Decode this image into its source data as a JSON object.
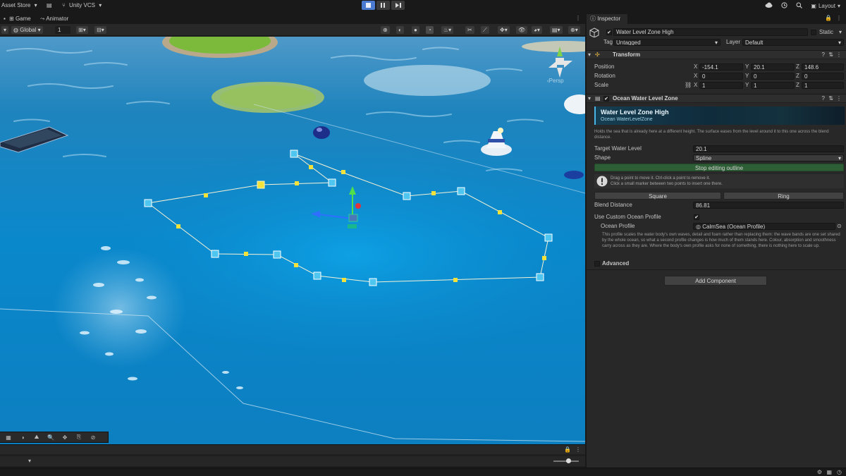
{
  "topbar": {
    "asset_store": "Asset Store",
    "vcs": "Unity VCS",
    "layout": "Layout"
  },
  "scene": {
    "tabs": [
      {
        "label": "Game"
      },
      {
        "label": "Animator"
      }
    ],
    "toolbar": {
      "pivot_space": "Global",
      "grid_value": "1"
    },
    "persp_label": "‹Persp"
  },
  "inspector": {
    "tab_label": "Inspector",
    "object": {
      "name": "Water Level Zone High",
      "static_label": "Static",
      "tag_label": "Tag",
      "tag_value": "Untagged",
      "layer_label": "Layer",
      "layer_value": "Default"
    },
    "transform": {
      "title": "Transform",
      "position_label": "Position",
      "rotation_label": "Rotation",
      "scale_label": "Scale",
      "x": "X",
      "y": "Y",
      "z": "Z",
      "position": [
        "-154.1",
        "20.1",
        "148.6"
      ],
      "rotation": [
        "0",
        "0",
        "0"
      ],
      "scale": [
        "1",
        "1",
        "1"
      ]
    },
    "zone": {
      "title": "Ocean Water Level Zone",
      "banner_title": "Water Level Zone High",
      "banner_subtitle": "Ocean WaterLevelZone",
      "description": "Holds the sea that is already here at a different height. The surface eases from the level around it to this one across the blend distance.",
      "target_label": "Target Water Level",
      "target_value": "20.1",
      "shape_label": "Shape",
      "shape_value": "Spline",
      "stop_editing": "Stop editing outline",
      "help_line1": "Drag a point to move it. Ctrl-click a point to remove it.",
      "help_line2": "Click a small marker between two points to insert one there.",
      "square_label": "Square",
      "ring_label": "Ring",
      "blend_label": "Blend Distance",
      "blend_value": "86.81",
      "custom_profile_label": "Use Custom Ocean Profile",
      "custom_profile_check": "✔",
      "profile_label": "Ocean Profile",
      "profile_value": "CalmSea (Ocean Profile)",
      "profile_desc": "This profile scales the water body's own waves, detail and foam rather than replacing them: the wave bands are one set shared by the whole ocean, so what a second profile changes is how much of them stands here. Colour, absorption and smoothness carry across as they are. Where the body's own profile asks for none of something, there is nothing here to scale up.",
      "advanced_label": "Advanced"
    },
    "add_component": "Add Component"
  },
  "colors": {
    "panel": "#282828",
    "accent_green": "#2e5e35",
    "handle_blue": "#4ac8f0",
    "handle_yellow": "#f2e23a"
  }
}
